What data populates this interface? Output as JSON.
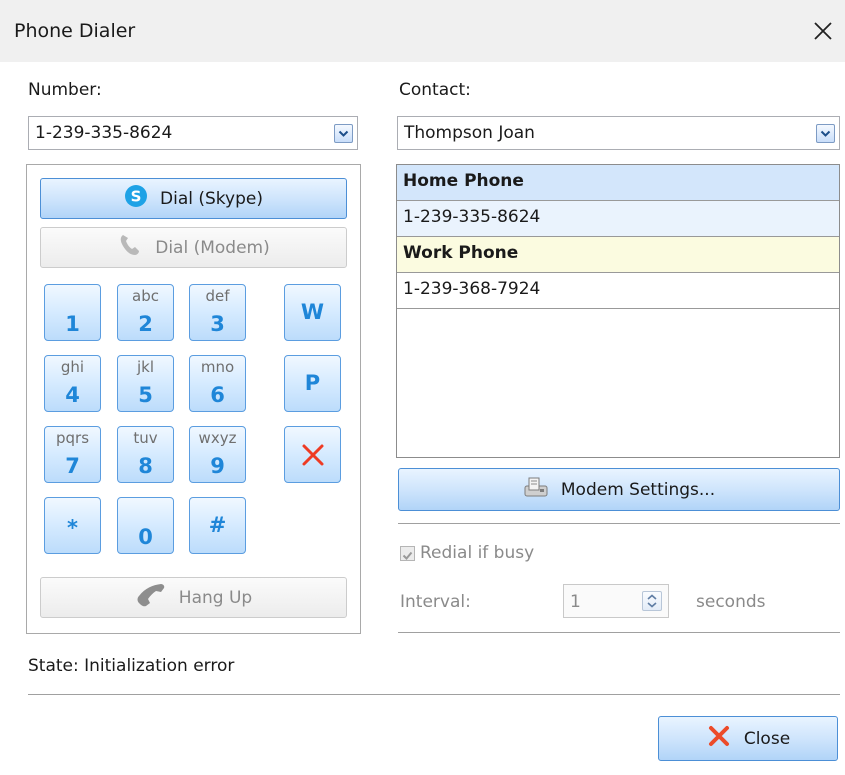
{
  "window": {
    "title": "Phone Dialer"
  },
  "number": {
    "label": "Number:",
    "value": "1-239-335-8624"
  },
  "contact": {
    "label": "Contact:",
    "value": "Thompson Joan"
  },
  "dial_skype_label": "Dial (Skype)",
  "dial_modem_label": "Dial (Modem)",
  "hang_up_label": "Hang Up",
  "keypad": {
    "k1": {
      "letters": "",
      "digit": "1"
    },
    "k2": {
      "letters": "abc",
      "digit": "2"
    },
    "k3": {
      "letters": "def",
      "digit": "3"
    },
    "k4": {
      "letters": "ghi",
      "digit": "4"
    },
    "k5": {
      "letters": "jkl",
      "digit": "5"
    },
    "k6": {
      "letters": "mno",
      "digit": "6"
    },
    "k7": {
      "letters": "pqrs",
      "digit": "7"
    },
    "k8": {
      "letters": "tuv",
      "digit": "8"
    },
    "k9": {
      "letters": "wxyz",
      "digit": "9"
    },
    "kstar": "*",
    "k0": "0",
    "khash": "#",
    "kw": "W",
    "kp": "P"
  },
  "phones": [
    {
      "type": "Home Phone",
      "number": "1-239-335-8624"
    },
    {
      "type": "Work Phone",
      "number": "1-239-368-7924"
    }
  ],
  "modem_settings_label": "Modem Settings...",
  "redial": {
    "label": "Redial if busy",
    "checked": true
  },
  "interval": {
    "label": "Interval:",
    "value": "1",
    "unit": "seconds"
  },
  "state_text": "State: Initialization error",
  "close_label": "Close",
  "colors": {
    "accent": "#1f86d8",
    "button_border": "#4c8fd6",
    "home_row": "#d3e6fb",
    "work_row": "#fbfbe0",
    "close_x": "#e8452c"
  },
  "icons": {
    "skype": "skype-icon",
    "modem_phone": "phone-handset-icon",
    "hang_up": "hang-up-handset-icon",
    "backspace": "red-x-icon",
    "modem_settings": "modem-settings-icon",
    "close": "red-x-icon"
  }
}
